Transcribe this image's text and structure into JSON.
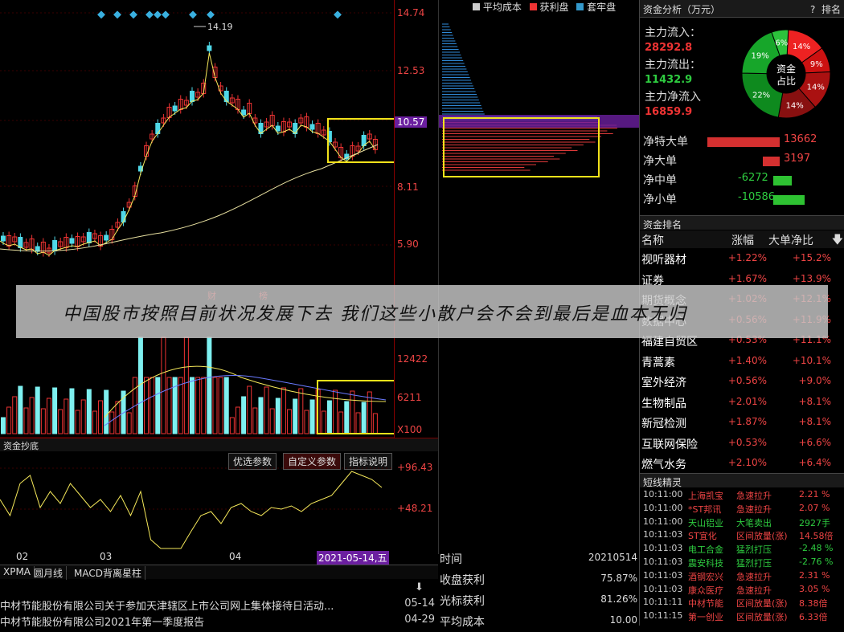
{
  "price_axis": [
    "14.74",
    "12.53",
    "10.57",
    "8.11",
    "5.90"
  ],
  "high_label": "14.19",
  "volume_axis": [
    "12422",
    "6211",
    "X100"
  ],
  "indicator_axis": [
    "+96.43",
    "+48.21"
  ],
  "x_axis_months": [
    "02",
    "03",
    "04"
  ],
  "current_date_label": "2021-05-14,五",
  "vol_markers": [
    "财",
    "榜"
  ],
  "legend": {
    "avg_cost": "平均成本",
    "profit": "获利盘",
    "trapped": "套牢盘"
  },
  "indicator": {
    "title": "资金抄底",
    "buttons": [
      "优选参数",
      "自定义参数",
      "指标说明"
    ]
  },
  "bottom_tabs": [
    "XPMA",
    "圆月线",
    "MACD背离星柱"
  ],
  "news": [
    {
      "title": "中材节能股份有限公司关于参加天津辖区上市公司网上集体接待日活动...",
      "date": "05-14"
    },
    {
      "title": "中材节能股份有限公司2021年第一季度报告",
      "date": "04-29"
    }
  ],
  "chip_info": {
    "rows": [
      {
        "key": "时间",
        "value": "20210514"
      },
      {
        "key": "收盘获利",
        "value": "75.87%"
      },
      {
        "key": "光标获利",
        "value": "81.26%"
      },
      {
        "key": "平均成本",
        "value": "10.00"
      }
    ]
  },
  "fund_analysis": {
    "title": "资金分析（万元）",
    "help": "?",
    "rank_link": "排名",
    "inflow_label": "主力流入：",
    "inflow_value": "28292.8",
    "outflow_label": "主力流出：",
    "outflow_value": "11432.9",
    "net_label": "主力净流入",
    "net_value": "16859.9",
    "donut_center": [
      "资金",
      "占比"
    ],
    "donut_slices": [
      {
        "label": "14%",
        "color": "#ee2222",
        "pct": 14
      },
      {
        "label": "9%",
        "color": "#cc1111",
        "pct": 9
      },
      {
        "label": "14%",
        "color": "#aa1111",
        "pct": 14
      },
      {
        "label": "14%",
        "color": "#881010",
        "pct": 14
      },
      {
        "label": "22%",
        "color": "#0e8a1e",
        "pct": 22
      },
      {
        "label": "19%",
        "color": "#17a62a",
        "pct": 19
      },
      {
        "label": "6%",
        "color": "#2cc23c",
        "pct": 6
      }
    ],
    "net_rows": [
      {
        "label": "净特大单",
        "value": "13662",
        "positive": true,
        "fill": 0.82
      },
      {
        "label": "净大单",
        "value": "3197",
        "positive": true,
        "fill": 0.19
      },
      {
        "label": "净中单",
        "value": "-6272",
        "positive": false,
        "fill": 0.38
      },
      {
        "label": "净小单",
        "value": "-10586",
        "positive": false,
        "fill": 0.65
      }
    ]
  },
  "fund_rank": {
    "title": "资金排名",
    "headers": [
      "名称",
      "涨幅",
      "大单净比"
    ],
    "rows": [
      {
        "name": "视听器材",
        "change": "+1.22%",
        "ratio": "+15.2%"
      },
      {
        "name": "证券",
        "change": "+1.67%",
        "ratio": "+13.9%"
      },
      {
        "name": "期货概念",
        "change": "+1.02%",
        "ratio": "+12.1%"
      },
      {
        "name": "数据中心",
        "change": "+0.56%",
        "ratio": "+11.9%"
      },
      {
        "name": "福建自贸区",
        "change": "+0.53%",
        "ratio": "+11.1%"
      },
      {
        "name": "青蒿素",
        "change": "+1.40%",
        "ratio": "+10.1%"
      },
      {
        "name": "室外经济",
        "change": "+0.56%",
        "ratio": "+9.0%"
      },
      {
        "name": "生物制品",
        "change": "+2.01%",
        "ratio": "+8.1%"
      },
      {
        "name": "新冠检测",
        "change": "+1.87%",
        "ratio": "+8.1%"
      },
      {
        "name": "互联网保险",
        "change": "+0.53%",
        "ratio": "+6.6%"
      },
      {
        "name": "燃气水务",
        "change": "+2.10%",
        "ratio": "+6.4%"
      }
    ]
  },
  "short_line": {
    "title": "短线精灵",
    "rows": [
      {
        "time": "10:11:00",
        "name": "上海凯宝",
        "event": "急速拉升",
        "value": "2.21 %"
      },
      {
        "time": "10:11:00",
        "name": "*ST邦讯",
        "event": "急速拉升",
        "value": "2.07 %"
      },
      {
        "time": "10:11:00",
        "name": "天山铝业",
        "event": "大笔卖出",
        "value": "2927手"
      },
      {
        "time": "10:11:03",
        "name": "ST宜化",
        "event": "区间放量(涨)",
        "value": "14.58倍"
      },
      {
        "time": "10:11:03",
        "name": "电工合金",
        "event": "猛烈打压",
        "value": "-2.48 %"
      },
      {
        "time": "10:11:03",
        "name": "震安科技",
        "event": "猛烈打压",
        "value": "-2.76 %"
      },
      {
        "time": "10:11:03",
        "name": "酒钢宏兴",
        "event": "急速拉升",
        "value": "2.31 %"
      },
      {
        "time": "10:11:03",
        "name": "康众医疗",
        "event": "急速拉升",
        "value": "3.05 %"
      },
      {
        "time": "10:11:11",
        "name": "中材节能",
        "event": "区间放量(涨)",
        "value": "8.38倍"
      },
      {
        "time": "10:11:15",
        "name": "第一创业",
        "event": "区间放量(涨)",
        "value": "6.33倍"
      }
    ]
  },
  "overlay_caption": "中国股市按照目前状况发展下去 我们这些小散户会不会到最后是血本无归"
}
